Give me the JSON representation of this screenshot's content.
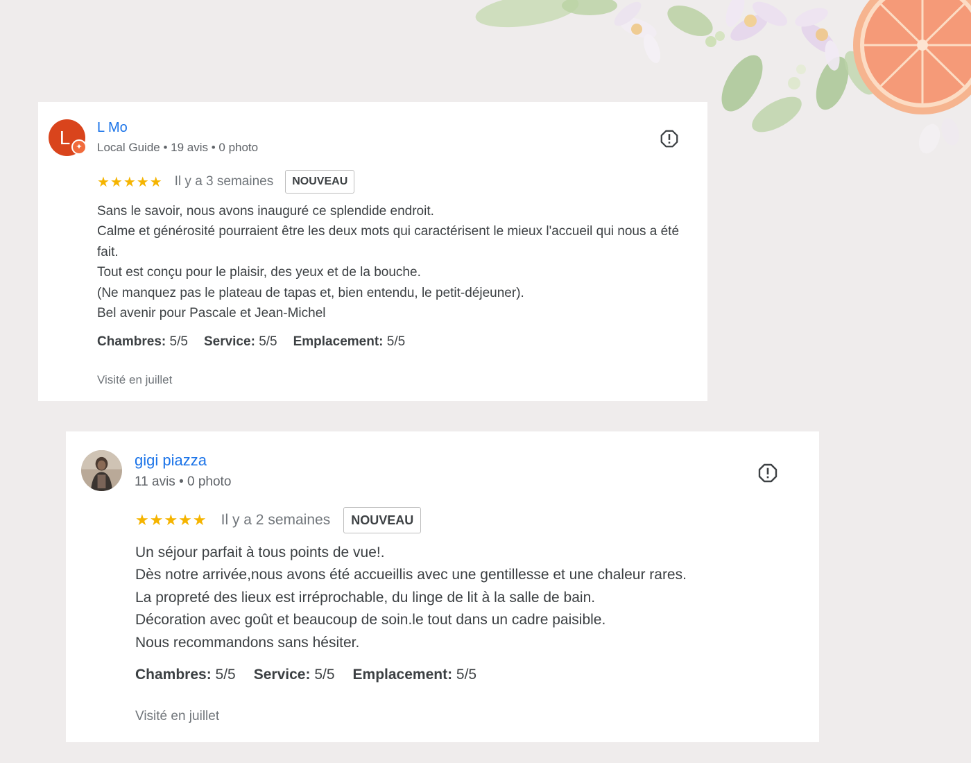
{
  "reviews": [
    {
      "author": {
        "name": "L Mo",
        "avatar_letter": "L",
        "meta": "Local Guide • 19 avis • 0 photo"
      },
      "stars_text": "★★★★★",
      "rating": 5,
      "rating_max": 5,
      "time_ago": "Il y a 3 semaines",
      "badge": "NOUVEAU",
      "body_lines": [
        "Sans le savoir, nous avons inauguré ce splendide endroit.",
        "Calme et générosité pourraient être les deux mots qui caractérisent le mieux l'accueil qui nous a été fait.",
        "Tout est conçu pour le plaisir, des yeux et de la bouche.",
        "(Ne manquez pas le plateau de tapas et, bien entendu, le petit-déjeuner).",
        "Bel avenir pour Pascale et Jean-Michel"
      ],
      "sub_ratings": [
        {
          "label": "Chambres:",
          "value": "5/5"
        },
        {
          "label": "Service:",
          "value": "5/5"
        },
        {
          "label": "Emplacement:",
          "value": "5/5"
        }
      ],
      "visited": "Visité en juillet"
    },
    {
      "author": {
        "name": "gigi piazza",
        "meta": "11 avis • 0 photo"
      },
      "stars_text": "★★★★★",
      "rating": 5,
      "rating_max": 5,
      "time_ago": "Il y a 2 semaines",
      "badge": "NOUVEAU",
      "body_lines": [
        "Un séjour parfait à tous points de vue!.",
        "Dès notre arrivée,nous avons été accueillis avec une gentillesse et une chaleur rares.",
        "La propreté des lieux est irréprochable, du linge de lit à la salle de bain.",
        "Décoration avec goût et beaucoup de soin.le tout dans un cadre paisible.",
        "Nous recommandons sans hésiter."
      ],
      "sub_ratings": [
        {
          "label": "Chambres:",
          "value": "5/5"
        },
        {
          "label": "Service:",
          "value": "5/5"
        },
        {
          "label": "Emplacement:",
          "value": "5/5"
        }
      ],
      "visited": "Visité en juillet"
    }
  ],
  "colors": {
    "background": "#efecec",
    "author_link": "#1a73e8",
    "star": "#f5b400",
    "avatar_l": "#d9441c"
  },
  "icons": {
    "report": "report-icon",
    "guide_badge": "local-guide-badge-icon"
  }
}
